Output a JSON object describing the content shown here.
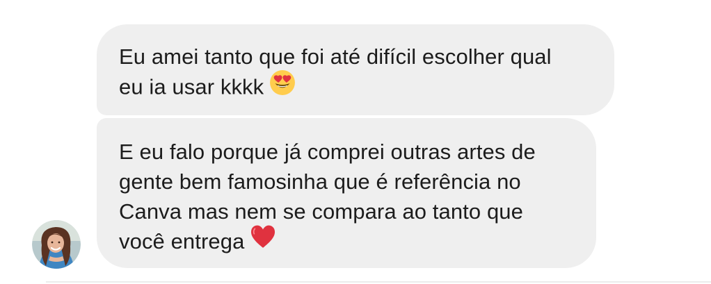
{
  "conversation": {
    "messages": [
      {
        "lines": [
          "Eu amei tanto que foi até difícil escolher qual",
          "eu ia usar kkkk"
        ],
        "emoji": "heart-eyes-emoji"
      },
      {
        "lines": [
          "E eu falo porque já comprei outras artes de",
          "gente bem famosinha que é referência no",
          "Canva mas nem se compara ao tanto que",
          "você entrega"
        ],
        "emoji": "red-heart-emoji"
      }
    ]
  },
  "colors": {
    "bubble_bg": "#efefef",
    "text": "#1c1c1c",
    "heart": "#e0323f",
    "emoji_face": "#ffcc4d"
  }
}
